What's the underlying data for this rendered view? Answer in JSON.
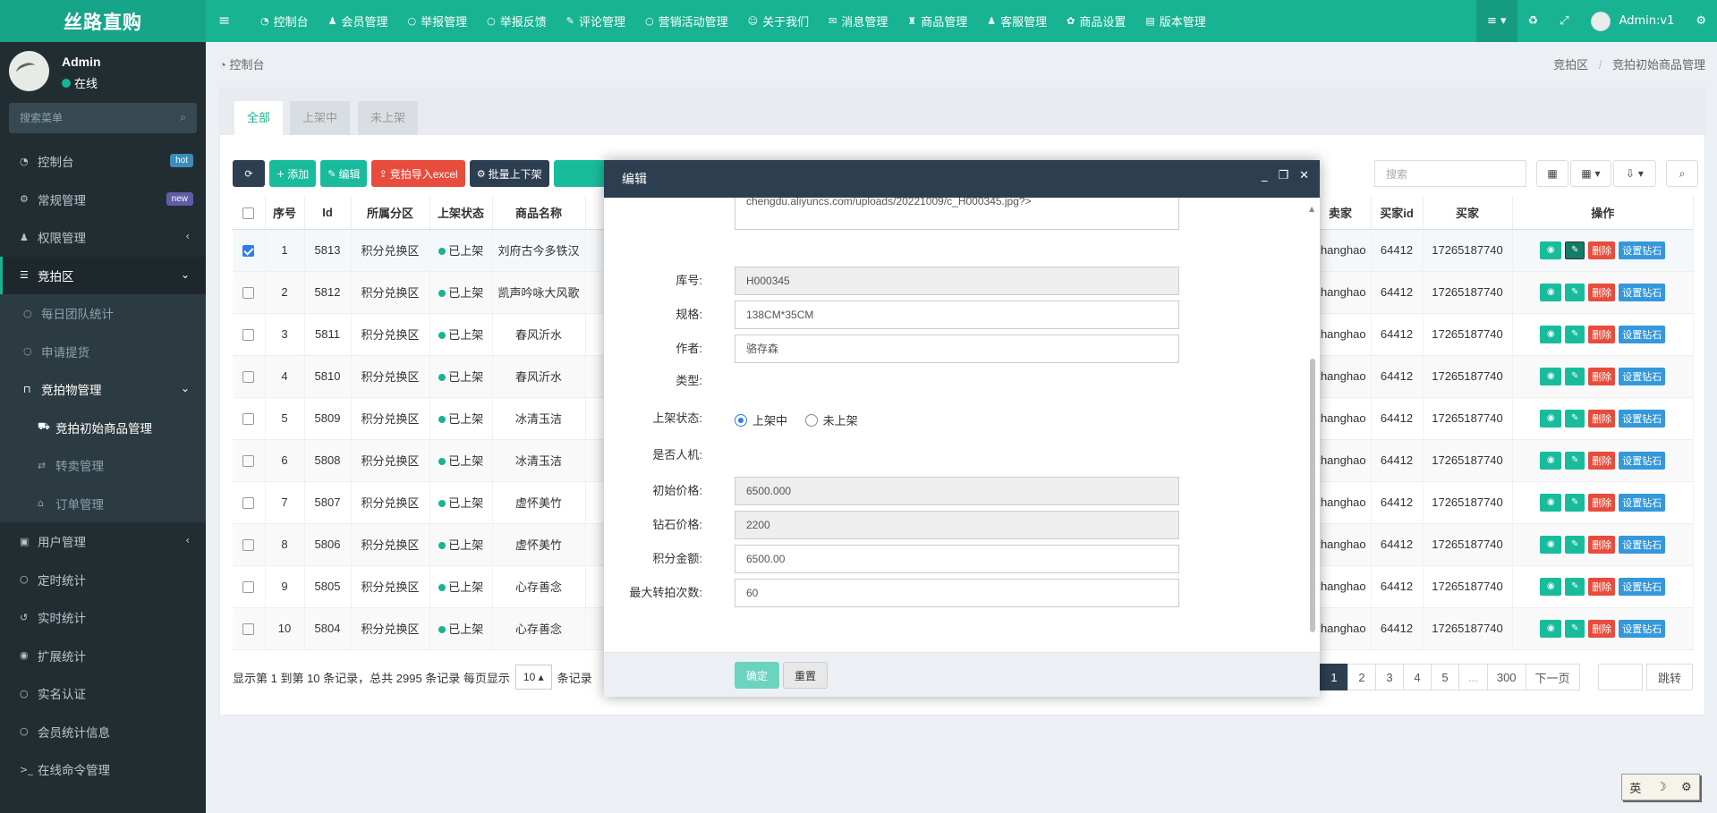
{
  "app": {
    "title": "丝路直购"
  },
  "topnav": [
    {
      "icon": "dashboard-icon",
      "glyph": "◔",
      "label": "控制台"
    },
    {
      "icon": "user-icon",
      "glyph": "♟",
      "label": "会员管理"
    },
    {
      "icon": "circle-icon",
      "glyph": "○",
      "label": "举报管理"
    },
    {
      "icon": "circle-icon",
      "glyph": "○",
      "label": "举报反馈"
    },
    {
      "icon": "comment-icon",
      "glyph": "✎",
      "label": "评论管理"
    },
    {
      "icon": "circle-icon",
      "glyph": "○",
      "label": "营销活动管理"
    },
    {
      "icon": "user-circle-icon",
      "glyph": "☺",
      "label": "关于我们"
    },
    {
      "icon": "comments-icon",
      "glyph": "✉",
      "label": "消息管理"
    },
    {
      "icon": "bank-icon",
      "glyph": "♜",
      "label": "商品管理"
    },
    {
      "icon": "user-tie-icon",
      "glyph": "♟",
      "label": "客服管理"
    },
    {
      "icon": "gift-icon",
      "glyph": "✿",
      "label": "商品设置"
    },
    {
      "icon": "file-icon",
      "glyph": "▤",
      "label": "版本管理"
    }
  ],
  "topright": {
    "user": "Admin:v1"
  },
  "user": {
    "name": "Admin",
    "status": "在线"
  },
  "sidebar": {
    "search_placeholder": "搜索菜单",
    "items": [
      {
        "label": "控制台",
        "badge": "hot"
      },
      {
        "label": "常规管理",
        "badge": "new"
      },
      {
        "label": "权限管理"
      },
      {
        "label": "竞拍区"
      },
      {
        "label": "每日团队统计"
      },
      {
        "label": "申请提货"
      },
      {
        "label": "竞拍物管理"
      },
      {
        "label": "竞拍初始商品管理"
      },
      {
        "label": "转卖管理"
      },
      {
        "label": "订单管理"
      },
      {
        "label": "用户管理"
      },
      {
        "label": "定时统计"
      },
      {
        "label": "实时统计"
      },
      {
        "label": "扩展统计"
      },
      {
        "label": "实名认证"
      },
      {
        "label": "会员统计信息"
      },
      {
        "label": "在线命令管理"
      }
    ]
  },
  "page": {
    "title": "控制台",
    "crumb1": "竞拍区",
    "crumb2": "竞拍初始商品管理"
  },
  "tabs": [
    "全部",
    "上架中",
    "未上架"
  ],
  "toolbar": {
    "add": "添加",
    "edit": "编辑",
    "import": "竞拍导入excel",
    "batch": "批量上下架",
    "search_placeholder": "搜索"
  },
  "table": {
    "headers": {
      "no": "序号",
      "id": "Id",
      "zone": "所属分区",
      "status": "上架状态",
      "name": "商品名称",
      "seller": "卖家",
      "buyer_id": "买家id",
      "buyer": "买家",
      "ops": "操作"
    },
    "action_labels": {
      "del": "删除",
      "diamond": "设置钻石"
    },
    "rows": [
      {
        "no": "1",
        "id": "5813",
        "zone": "积分兑换区",
        "status": "已上架",
        "name": "刘府古今多铁汉",
        "seller": "zhanghao",
        "buyer_id": "64412",
        "buyer": "17265187740",
        "checked": true
      },
      {
        "no": "2",
        "id": "5812",
        "zone": "积分兑换区",
        "status": "已上架",
        "name": "凯声吟咏大风歌",
        "seller": "zhanghao",
        "buyer_id": "64412",
        "buyer": "17265187740"
      },
      {
        "no": "3",
        "id": "5811",
        "zone": "积分兑换区",
        "status": "已上架",
        "name": "春风沂水",
        "seller": "zhanghao",
        "buyer_id": "64412",
        "buyer": "17265187740"
      },
      {
        "no": "4",
        "id": "5810",
        "zone": "积分兑换区",
        "status": "已上架",
        "name": "春风沂水",
        "seller": "zhanghao",
        "buyer_id": "64412",
        "buyer": "17265187740"
      },
      {
        "no": "5",
        "id": "5809",
        "zone": "积分兑换区",
        "status": "已上架",
        "name": "冰清玉洁",
        "seller": "zhanghao",
        "buyer_id": "64412",
        "buyer": "17265187740"
      },
      {
        "no": "6",
        "id": "5808",
        "zone": "积分兑换区",
        "status": "已上架",
        "name": "冰清玉洁",
        "seller": "zhanghao",
        "buyer_id": "64412",
        "buyer": "17265187740"
      },
      {
        "no": "7",
        "id": "5807",
        "zone": "积分兑换区",
        "status": "已上架",
        "name": "虚怀美竹",
        "seller": "zhanghao",
        "buyer_id": "64412",
        "buyer": "17265187740"
      },
      {
        "no": "8",
        "id": "5806",
        "zone": "积分兑换区",
        "status": "已上架",
        "name": "虚怀美竹",
        "seller": "zhanghao",
        "buyer_id": "64412",
        "buyer": "17265187740"
      },
      {
        "no": "9",
        "id": "5805",
        "zone": "积分兑换区",
        "status": "已上架",
        "name": "心存善念",
        "seller": "zhanghao",
        "buyer_id": "64412",
        "buyer": "17265187740"
      },
      {
        "no": "10",
        "id": "5804",
        "zone": "积分兑换区",
        "status": "已上架",
        "name": "心存善念",
        "seller": "zhanghao",
        "buyer_id": "64412",
        "buyer": "17265187740"
      }
    ]
  },
  "pagination": {
    "info": "显示第 1 到第 10 条记录，总共 2995 条记录 每页显示",
    "per_page": "10",
    "suffix": "条记录",
    "pages": [
      "1",
      "2",
      "3",
      "4",
      "5",
      "...",
      "300",
      "下一页"
    ],
    "jump": "跳转"
  },
  "modal": {
    "title": "编辑",
    "url_fragment": "chengdu.aliyuncs.com/uploads/20221009/c_H000345.jpg?>",
    "fields": [
      {
        "label": "库号:",
        "value": "H000345",
        "readonly": true
      },
      {
        "label": "规格:",
        "value": "138CM*35CM",
        "readonly": false
      },
      {
        "label": "作者:",
        "value": "骆存森",
        "readonly": false
      }
    ],
    "type_label": "类型:",
    "status_label": "上架状态:",
    "radio_on": "上架中",
    "radio_off": "未上架",
    "robot_label": "是否人机:",
    "fields2": [
      {
        "label": "初始价格:",
        "value": "6500.000",
        "readonly": true
      },
      {
        "label": "钻石价格:",
        "value": "2200",
        "readonly": true
      },
      {
        "label": "积分金额:",
        "value": "6500.00",
        "readonly": false
      },
      {
        "label": "最大转拍次数:",
        "value": "60",
        "readonly": false
      }
    ],
    "ok": "确定",
    "reset": "重置"
  },
  "ime": [
    "英",
    "☽",
    "⚙"
  ]
}
